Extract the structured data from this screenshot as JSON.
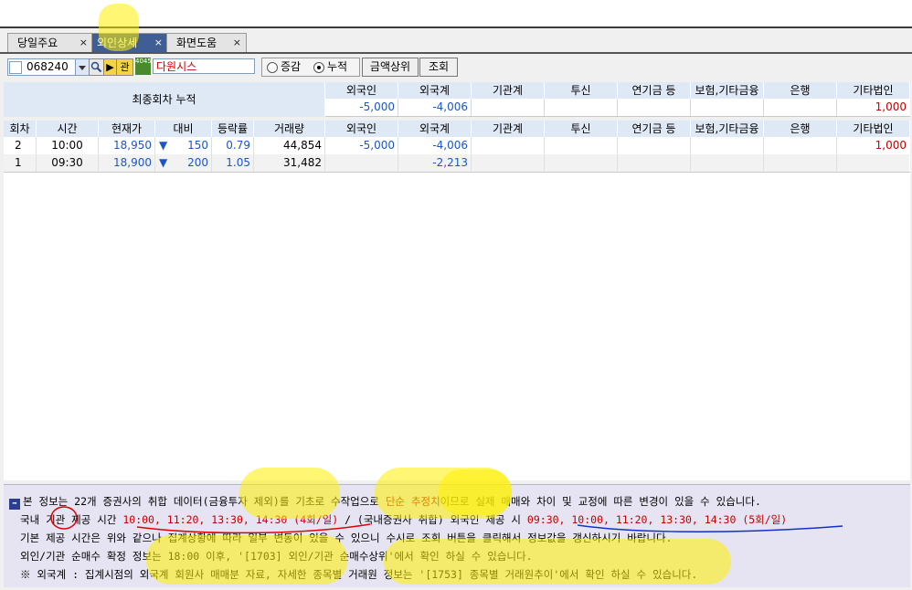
{
  "tabs": [
    {
      "label": "당일주요",
      "close": "×"
    },
    {
      "label": "외인상세",
      "close": "×"
    },
    {
      "label": "화면도움",
      "close": "×"
    }
  ],
  "toolbar": {
    "code": "068240",
    "search_icon": "magnifier-icon",
    "detail_btn": "관",
    "badge": "4045",
    "stock_name": "다원시스",
    "radio_change": "증감",
    "radio_cumulative": "누적",
    "amount_btn": "금액상위",
    "query_btn": "조회"
  },
  "summary": {
    "label": "최종회차 누적",
    "headers": [
      "외국인",
      "외국계",
      "기관계",
      "투신",
      "연기금 등",
      "보험,기타금융",
      "은행",
      "기타법인"
    ],
    "values": [
      "-5,000",
      "-4,006",
      "",
      "",
      "",
      "",
      "",
      "1,000"
    ]
  },
  "table": {
    "headers": [
      "회차",
      "시간",
      "현재가",
      "대비",
      "등락률",
      "거래량",
      "외국인",
      "외국계",
      "기관계",
      "투신",
      "연기금 등",
      "보험,기타금융",
      "은행",
      "기타법인"
    ],
    "rows": [
      {
        "round": "2",
        "time": "10:00",
        "price": "18,950",
        "dir": "▼",
        "change": "150",
        "rate": "0.79",
        "volume": "44,854",
        "foreign": "-5,000",
        "foreign_firm": "-4,006",
        "inst": "",
        "trust": "",
        "pension": "",
        "insurance": "",
        "bank": "",
        "other": "1,000"
      },
      {
        "round": "1",
        "time": "09:30",
        "price": "18,900",
        "dir": "▼",
        "change": "200",
        "rate": "1.05",
        "volume": "31,482",
        "foreign": "",
        "foreign_firm": "-2,213",
        "inst": "",
        "trust": "",
        "pension": "",
        "insurance": "",
        "bank": "",
        "other": ""
      }
    ]
  },
  "info": {
    "line1a": "본 정보는 22개 증권사의 취합 데이터(금융투자 제외)를 기초로 수작업으로 ",
    "line1b": "단순 추정치",
    "line1c": "이므로 실제 매매와 차이 및 교정에 따른 변경이 있을 수 있습니다.",
    "line2a": "국내 기관 제공 시간 ",
    "line2b": "10:00, 11:20, 13:30, 14:30 (4회/일)",
    "line2c": " / (국내증권사 취합) 외국인 제공 시 ",
    "line2d": "09:30, 10:00, 11:20, 13:30, 14:30 (5회/일)",
    "line3": "기본 제공 시간은 위와 같으나 집계상황에 따라 일부 변동이 있을 수 있으니 수시로 조회 버튼을 클릭해서 정보값을 갱신하시기 바랍니다.",
    "line4": "외인/기관 순매수 확정 정보는 18:00 이후, '[1703] 외인/기관 순매수상위'에서 확인 하실 수 있습니다.",
    "line5": "※ 외국계 : 집계시점의 외국계 회원사 매매분 자료, 자세한 종목별 거래원 정보는 '[1753] 종목별 거래원추이'에서 확인 하실 수 있습니다."
  },
  "colors": {
    "accent": "#3f5e94",
    "header_bg": "#dfe8f5",
    "positive": "#c20000",
    "negative": "#1d55c5",
    "info_bg": "#e6e4f2"
  }
}
